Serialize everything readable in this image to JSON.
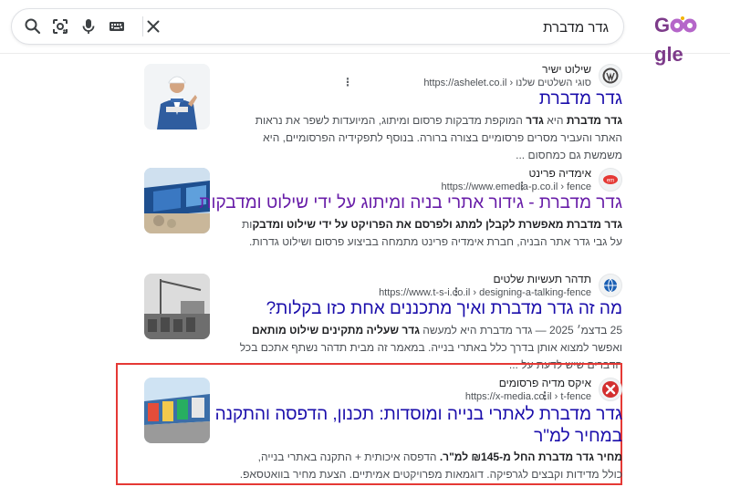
{
  "search": {
    "query": "גדר מדברת",
    "clear_icon": "close-icon",
    "keyboard_icon": "keyboard-icon",
    "mic_icon": "mic-icon",
    "lens_icon": "lens-icon",
    "search_icon": "search-icon"
  },
  "logo": {
    "text_start": "G",
    "text_end": "gle"
  },
  "results": [
    {
      "site_name": "שילוט ישיר",
      "url": "https://ashelet.co.il › סוגי השלטים שלנו",
      "favicon": "wordpress-icon",
      "title": "גדר מדברת",
      "snippet_bold_1": "גדר מדברת",
      "snippet_1": " היא ",
      "snippet_bold_2": "גדר",
      "snippet_2": " המוקפת מדבקות פרסום ומיתוג, המיועדות לשפר את נראות האתר והעביר מסרים פרסומיים בצורה ברורה. בנוסף לתפקידיה הפרסומיים, היא משמשת גם כמחסום ..."
    },
    {
      "site_name": "אימדיה פרינט",
      "url": "https://www.emedia-p.co.il › fence",
      "favicon": "emedia-icon",
      "title": "גדר מדברת - גידור אתרי בניה ומיתוג על ידי שילוט ומדבקות",
      "snippet_bold_1": "גדר מדברת מאפשרת לקבלן למתג ולפרסם את הפרויקט על ידי שילוט ומדבק",
      "snippet_1": "ות על גבי גדר אתר הבניה, חברת אימדיה פרינט מתמחה בביצוע פרסום ושילוט גדרות.",
      "snippet_bold_2": "",
      "snippet_2": ""
    },
    {
      "site_name": "תדהר תעשיות שלטים",
      "url": "https://www.t-s-i.co.il › designing-a-talking-fence",
      "favicon": "globe-icon",
      "title": "מה זה גדר מדברת ואיך מתכננים אחת כזו בקלות?",
      "snippet_1": "25 בדצמ׳ 2025 — גדר מדברת היא למעשה ",
      "snippet_bold_1": "גדר שעליה מתקינים שילוט מותאם",
      "snippet_2": " ואפשר למצוא אותן בדרך כלל באתרי בנייה. במאמר זה מבית תדהר נשתף אתכם בכל הדברים שיש לדעת על ...",
      "snippet_bold_2": ""
    },
    {
      "site_name": "איקס מדיה פרסומים",
      "url": "https://x-media.co.il › t-fence",
      "favicon": "x-media-icon",
      "title_line1": "גדר מדברת לאתרי בנייה ומוסדות: תכנון, הדפסה והתקנה",
      "title_line2": "במחיר למ\"ר",
      "snippet_bold_1": "מחיר גדר מדברת החל מ-₪145 למ\"ר.",
      "snippet_1": " הדפסה איכותית + התקנה באתרי בנייה, כולל מדידות וקבצים לגרפיקה. דוגמאות מפרויקטים אמיתיים. הצעת מחיר בוואטסאפ.",
      "snippet_bold_2": "",
      "snippet_2": ""
    }
  ],
  "colors": {
    "link": "#1a0dab",
    "visited": "#681da8",
    "highlight": "#e53935"
  }
}
